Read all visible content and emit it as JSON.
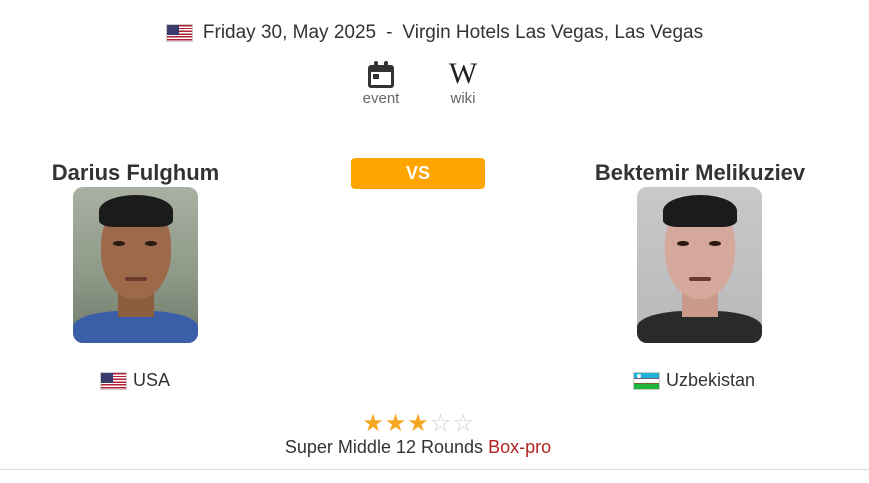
{
  "event": {
    "flag_icon": "us-flag-icon",
    "date": "Friday 30, May 2025",
    "separator": "-",
    "venue": "Virgin Hotels Las Vegas, Las Vegas",
    "links": [
      {
        "icon": "calendar-icon",
        "label": "event"
      },
      {
        "icon": "wikipedia-icon",
        "glyph": "W",
        "label": "wiki"
      }
    ]
  },
  "vs_label": "VS",
  "fighters": {
    "left": {
      "name": "Darius Fulghum",
      "country": "USA",
      "flag_icon": "us-flag-icon"
    },
    "right": {
      "name": "Bektemir Melikuziev",
      "country": "Uzbekistan",
      "flag_icon": "uzbekistan-flag-icon"
    }
  },
  "rating": {
    "value": 3,
    "max": 5
  },
  "fight": {
    "weight_class": "Super Middle",
    "rounds": "12 Rounds",
    "type": "Box-pro"
  },
  "colors": {
    "accent": "#ffa500",
    "star": "#f5a623",
    "fight_type": "#b22222"
  }
}
